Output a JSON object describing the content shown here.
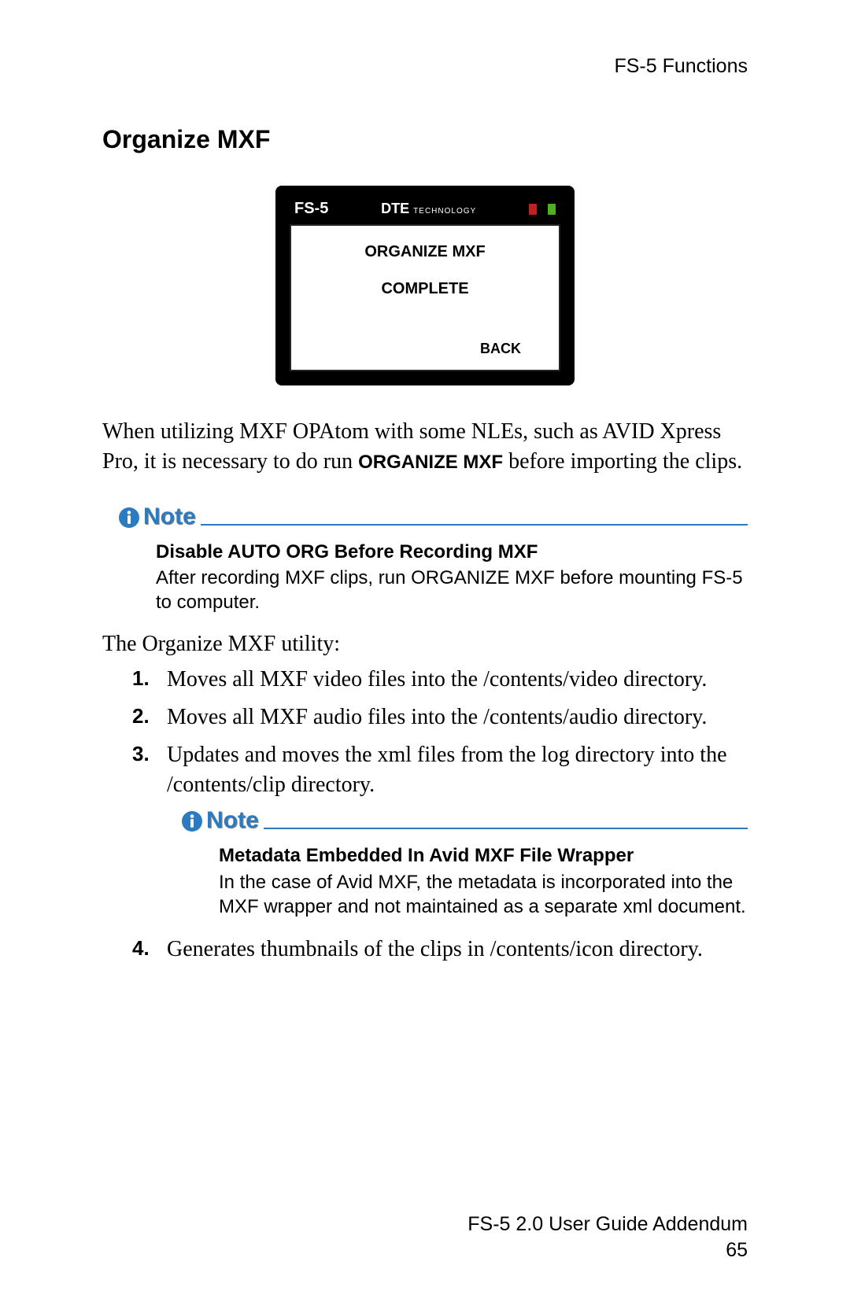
{
  "header": {
    "section_label": "FS-5 Functions"
  },
  "heading": "Organize MXF",
  "device": {
    "brand": "FS-5",
    "tech_prefix": "DTE",
    "tech_suffix": "TECHNOLOGY",
    "screen": {
      "line1": "ORGANIZE MXF",
      "line2": "COMPLETE",
      "back": "BACK"
    }
  },
  "para1_pre": "When utilizing MXF OPAtom with some NLEs, such as AVID Xpress Pro, it is necessary to do run ",
  "para1_bold": "ORGANIZE MXF",
  "para1_post": " before importing the clips.",
  "note1": {
    "label": "Note",
    "heading": "Disable AUTO ORG Before Recording MXF",
    "body": "After recording MXF clips, run ORGANIZE MXF before mounting FS-5 to computer."
  },
  "list_intro": "The Organize MXF utility:",
  "items": {
    "n1": "1.",
    "t1": "Moves all MXF video files into the /contents/video directory.",
    "n2": "2.",
    "t2": "Moves all MXF audio files into the /contents/audio directory.",
    "n3": "3.",
    "t3": "Updates and moves the xml files from the log directory into the /contents/clip directory.",
    "n4": "4.",
    "t4": "Generates thumbnails of the clips in /contents/icon directory."
  },
  "note2": {
    "label": "Note",
    "heading": "Metadata Embedded In Avid MXF File Wrapper",
    "body": "In the case of Avid MXF, the metadata is incorporated into the MXF wrapper and not maintained as a separate xml document."
  },
  "footer": {
    "text": "FS-5 2.0 User Guide Addendum",
    "page": "65"
  }
}
